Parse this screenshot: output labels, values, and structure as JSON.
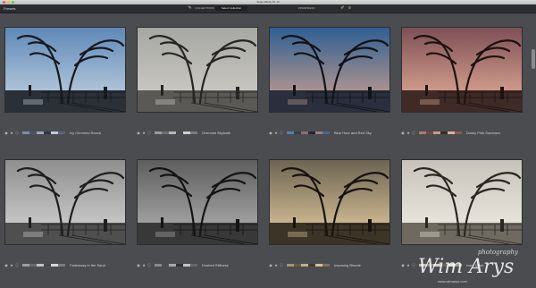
{
  "window": {
    "title": "Snap Affinity P1 10"
  },
  "toolbar": {
    "panel_label": "Presets",
    "tabs": [
      "COLLECTIONS",
      "Select Collection",
      "OPENPRESS"
    ],
    "active_tab": 1
  },
  "presets": [
    {
      "label": "Ivy Chromex Rezza",
      "tint": "blue",
      "swatches": [
        "#7d8fa6",
        "#4a5565",
        "#9aa7b6",
        "#2f3640",
        "#c0c8d2",
        "#59667a"
      ]
    },
    {
      "label": "Overcast Skywalk",
      "tint": "gray",
      "swatches": [
        "#9a9a96",
        "#6e6e6b",
        "#b7b6b1",
        "#4b4b49",
        "#d0cfca",
        "#7e7d79"
      ]
    },
    {
      "label": "Blue Hour and Red Sky",
      "tint": "dusk",
      "swatches": [
        "#5c7fa8",
        "#2f3e57",
        "#8f6c6a",
        "#1f2838",
        "#a07e76",
        "#456a92"
      ]
    },
    {
      "label": "Dusky Pink Sundown",
      "tint": "pink",
      "swatches": [
        "#b07a72",
        "#6e4740",
        "#c99d8f",
        "#3e2824",
        "#d8b2a2",
        "#8a5a50"
      ]
    },
    {
      "label": "Fadeaway in the Sand",
      "tint": "bw",
      "swatches": [
        "#9e9e9e",
        "#6a6a6a",
        "#c2c2c2",
        "#474747",
        "#d8d8d8",
        "#7d7d7d"
      ]
    },
    {
      "label": "Hushed Stillness",
      "tint": "dark",
      "swatches": [
        "#8c8c8c",
        "#4e4e4e",
        "#a9a9a9",
        "#333333",
        "#c4c4c4",
        "#666666"
      ]
    },
    {
      "label": "Imposing Blonde",
      "tint": "gold",
      "swatches": [
        "#a8946e",
        "#6b5a3e",
        "#c2ad86",
        "#463a28",
        "#d2c09a",
        "#85704e"
      ]
    },
    {
      "label": "Ivory Quiet",
      "tint": "ivory",
      "swatches": [
        "#bdb8ae",
        "#8d877c",
        "#d6d1c6",
        "#6a655c",
        "#e6e1d6",
        "#a29c90"
      ]
    }
  ],
  "tints": {
    "blue": {
      "sky_top": "#5f88b8",
      "sky_bottom": "#c8d6e2",
      "ground": "#2a3038",
      "line": "#16191e"
    },
    "gray": {
      "sky_top": "#a6a6a2",
      "sky_bottom": "#d2d1cc",
      "ground": "#5a5956",
      "line": "#262523"
    },
    "dusk": {
      "sky_top": "#2f5f92",
      "sky_bottom": "#d2a28e",
      "ground": "#2a2f3e",
      "line": "#10131a"
    },
    "pink": {
      "sky_top": "#7e4f56",
      "sky_bottom": "#e9b29a",
      "ground": "#3f2a26",
      "line": "#1d1210"
    },
    "bw": {
      "sky_top": "#8f8f8f",
      "sky_bottom": "#d6d6d6",
      "ground": "#4f4f4f",
      "line": "#1e1e1e"
    },
    "dark": {
      "sky_top": "#5e5e5e",
      "sky_bottom": "#b4b4b4",
      "ground": "#383838",
      "line": "#141414"
    },
    "gold": {
      "sky_top": "#6d6452",
      "sky_bottom": "#e7cfa2",
      "ground": "#3c3426",
      "line": "#17130c"
    },
    "ivory": {
      "sky_top": "#c7c3ba",
      "sky_bottom": "#f1eee6",
      "ground": "#6f6a60",
      "line": "#2a2722"
    }
  },
  "watermark": {
    "name": "Wim Arys",
    "tag": "photography",
    "url": "www.wimarys.com"
  }
}
